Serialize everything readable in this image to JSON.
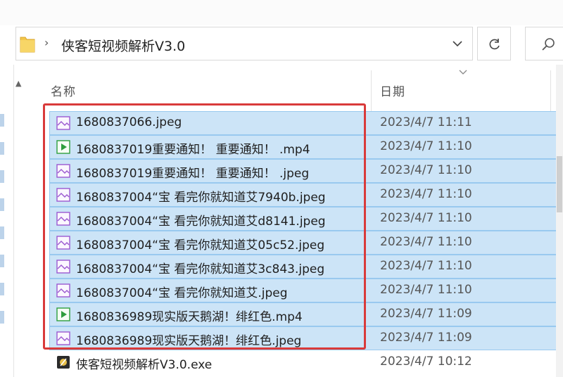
{
  "address_bar": {
    "separator": "›",
    "folder_name": "侠客短视频解析V3.0"
  },
  "columns": {
    "name": "名称",
    "date": "日期"
  },
  "files": [
    {
      "name": "1680837066.jpeg",
      "date": "2023/4/7 11:11",
      "type": "image",
      "selected": true
    },
    {
      "name": "1680837019重要通知！ 重要通知！ .mp4",
      "date": "2023/4/7 11:10",
      "type": "video",
      "selected": true
    },
    {
      "name": "1680837019重要通知！ 重要通知！ .jpeg",
      "date": "2023/4/7 11:10",
      "type": "image",
      "selected": true
    },
    {
      "name": "1680837004“宝 看完你就知道艾7940b.jpeg",
      "date": "2023/4/7 11:10",
      "type": "image",
      "selected": true
    },
    {
      "name": "1680837004“宝 看完你就知道艾d8141.jpeg",
      "date": "2023/4/7 11:10",
      "type": "image",
      "selected": true
    },
    {
      "name": "1680837004“宝 看完你就知道艾05c52.jpeg",
      "date": "2023/4/7 11:10",
      "type": "image",
      "selected": true
    },
    {
      "name": "1680837004“宝 看完你就知道艾3c843.jpeg",
      "date": "2023/4/7 11:10",
      "type": "image",
      "selected": true
    },
    {
      "name": "1680837004“宝 看完你就知道艾.jpeg",
      "date": "2023/4/7 11:10",
      "type": "image",
      "selected": true
    },
    {
      "name": "1680836989现实版天鹅湖！绯红色.mp4",
      "date": "2023/4/7 11:09",
      "type": "video",
      "selected": true
    },
    {
      "name": "1680836989现实版天鹅湖！绯红色.jpeg",
      "date": "2023/4/7 11:09",
      "type": "image",
      "selected": true
    },
    {
      "name": "侠客短视频解析V3.0.exe",
      "date": "2023/4/7 10:12",
      "type": "exe",
      "selected": false
    }
  ],
  "colors": {
    "selection": "#cce4f7",
    "selection_border": "#99c9ef",
    "annotation_frame": "#d93a3a",
    "image_icon_accent": "#9b59d0",
    "video_icon_accent": "#2e9e3e"
  },
  "icons": {
    "folder": "folder-icon",
    "dropdown": "chevron-down-icon",
    "refresh": "refresh-icon",
    "search": "search-icon",
    "image_file": "image-file-icon",
    "video_file": "video-file-icon",
    "exe_file": "application-icon"
  }
}
